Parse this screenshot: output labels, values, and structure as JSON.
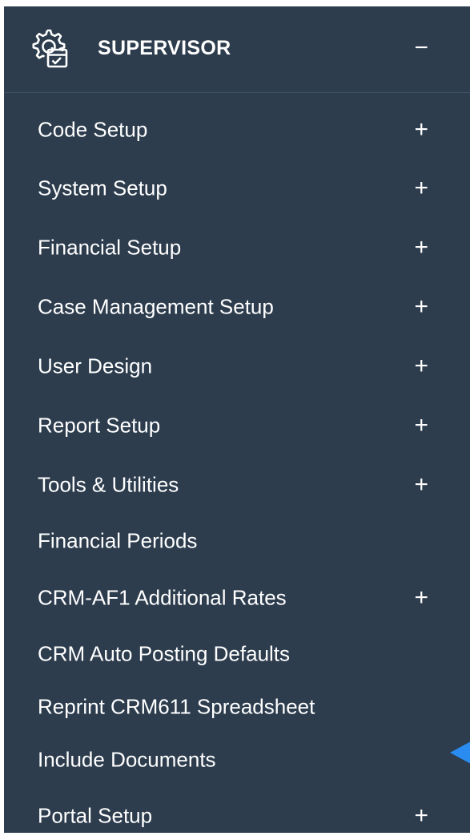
{
  "header": {
    "title": "SUPERVISOR",
    "toggle": "−",
    "icon": "gear-calendar-icon"
  },
  "menu": {
    "items": [
      {
        "label": "Code Setup",
        "expand": "+"
      },
      {
        "label": "System Setup",
        "expand": "+"
      },
      {
        "label": "Financial Setup",
        "expand": "+"
      },
      {
        "label": "Case Management Setup",
        "expand": "+"
      },
      {
        "label": "User Design",
        "expand": "+"
      },
      {
        "label": "Report Setup",
        "expand": "+"
      },
      {
        "label": "Tools & Utilities",
        "expand": "+"
      },
      {
        "label": "Financial Periods",
        "expand": ""
      },
      {
        "label": "CRM-AF1 Additional Rates",
        "expand": "+"
      },
      {
        "label": "CRM Auto Posting Defaults",
        "expand": ""
      },
      {
        "label": "Reprint CRM611 Spreadsheet",
        "expand": ""
      },
      {
        "label": "Include Documents",
        "expand": ""
      },
      {
        "label": "Portal Setup",
        "expand": "+"
      }
    ]
  },
  "colors": {
    "panel_bg": "#2d3d4e",
    "text": "#ffffff",
    "pointer": "#2a8cf0"
  }
}
